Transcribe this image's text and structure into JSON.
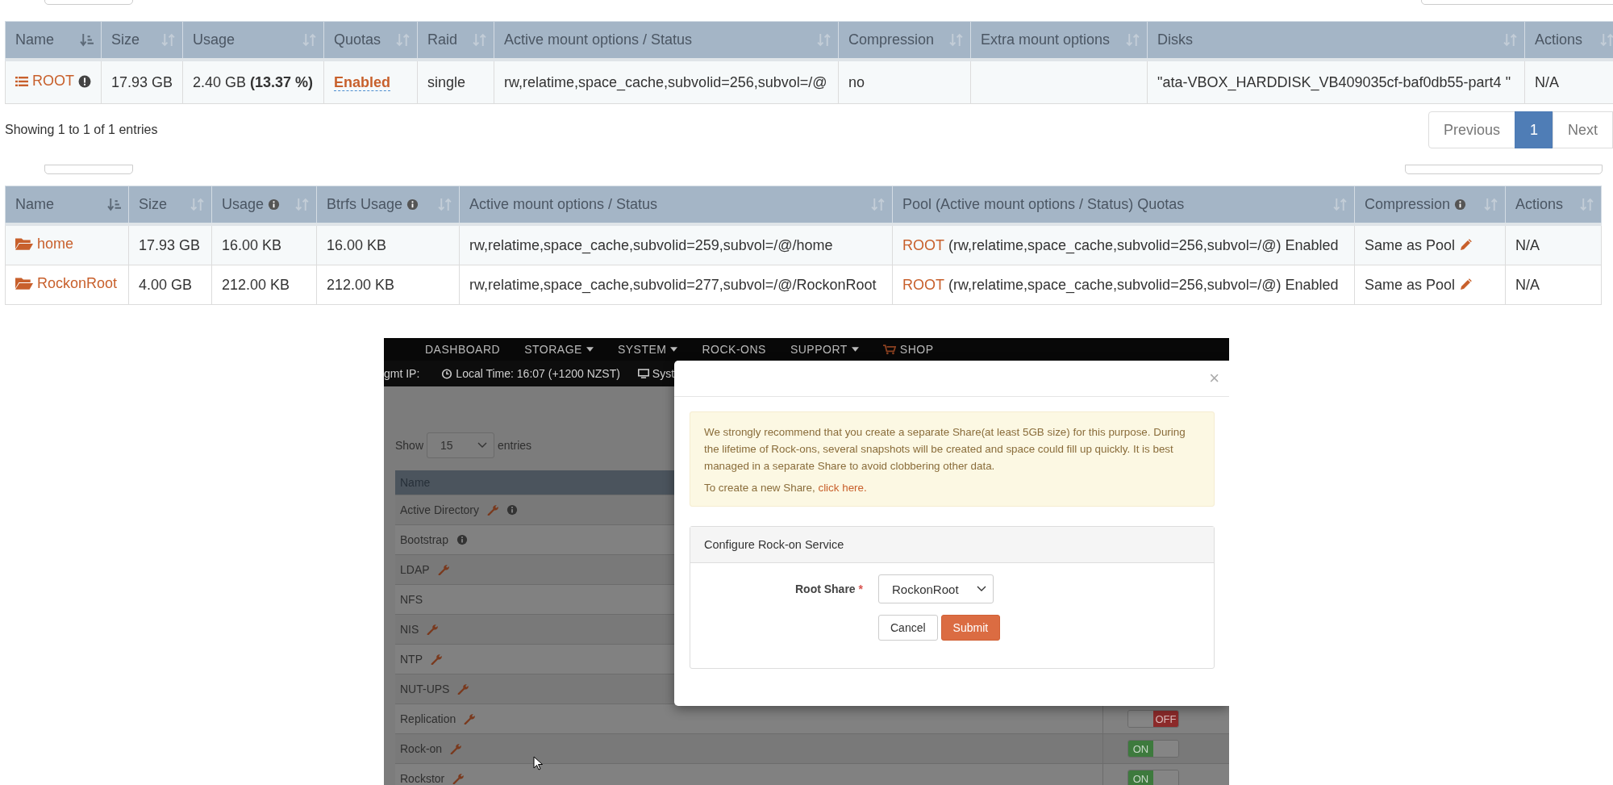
{
  "pools_table": {
    "columns": [
      {
        "label": "Name",
        "sorted": true,
        "info": false
      },
      {
        "label": "Size",
        "sorted": false,
        "info": false
      },
      {
        "label": "Usage",
        "sorted": false,
        "info": false
      },
      {
        "label": "Quotas",
        "sorted": false,
        "info": false
      },
      {
        "label": "Raid",
        "sorted": false,
        "info": false
      },
      {
        "label": "Active mount options / Status",
        "sorted": false,
        "info": false
      },
      {
        "label": "Compression",
        "sorted": false,
        "info": false
      },
      {
        "label": "Extra mount options",
        "sorted": false,
        "info": false
      },
      {
        "label": "Disks",
        "sorted": false,
        "info": false
      },
      {
        "label": "Actions",
        "sorted": false,
        "info": false
      }
    ],
    "rows": [
      {
        "cells": [
          {
            "kind": "pool-link",
            "text": "ROOT"
          },
          {
            "kind": "text",
            "text": "17.93 GB"
          },
          {
            "kind": "text",
            "text": "2.40 GB **(13.37 %)**"
          },
          {
            "kind": "quota-link",
            "text": "Enabled"
          },
          {
            "kind": "text",
            "text": "single"
          },
          {
            "kind": "text",
            "text": "rw,relatime,space_cache,subvolid=256,subvol=/@"
          },
          {
            "kind": "text",
            "text": "no"
          },
          {
            "kind": "empty"
          },
          {
            "kind": "text",
            "text": "\"ata-VBOX_HARDDISK_VB409035cf-baf0db55-part4 \""
          },
          {
            "kind": "text",
            "text": "N/A"
          }
        ]
      }
    ]
  },
  "pools_info": "Showing 1 to 1 of 1 entries",
  "pagination": [
    {
      "label": "Previous",
      "selected": false
    },
    {
      "label": "1",
      "selected": true
    },
    {
      "label": "Next",
      "selected": false
    }
  ],
  "shares_table": {
    "columns": [
      {
        "label": "Name",
        "sorted": true,
        "info": false
      },
      {
        "label": "Size",
        "sorted": false,
        "info": false
      },
      {
        "label": "Usage",
        "sorted": false,
        "info": true
      },
      {
        "label": "Btrfs Usage",
        "sorted": false,
        "info": true
      },
      {
        "label": "Active mount options / Status",
        "sorted": false,
        "info": false
      },
      {
        "label": "Pool (Active mount options / Status) Quotas",
        "sorted": false,
        "info": false
      },
      {
        "label": "Compression",
        "sorted": false,
        "info": true
      },
      {
        "label": "Actions",
        "sorted": false,
        "info": false
      }
    ],
    "rows": [
      {
        "cells": [
          {
            "kind": "share-link",
            "text": "home"
          },
          {
            "kind": "text",
            "text": "17.93 GB"
          },
          {
            "kind": "text",
            "text": "16.00 KB"
          },
          {
            "kind": "text",
            "text": "16.00 KB"
          },
          {
            "kind": "text",
            "text": "rw,relatime,space_cache,subvolid=259,subvol=/@/home"
          },
          {
            "kind": "pool-ref",
            "link": "ROOT",
            "text": "(rw,relatime,space_cache,subvolid=256,subvol=/@) Enabled"
          },
          {
            "kind": "editable",
            "text": "Same as Pool"
          },
          {
            "kind": "text",
            "text": "N/A"
          }
        ]
      },
      {
        "cells": [
          {
            "kind": "share-link",
            "text": "RockonRoot"
          },
          {
            "kind": "text",
            "text": "4.00 GB"
          },
          {
            "kind": "text",
            "text": "212.00 KB"
          },
          {
            "kind": "text",
            "text": "212.00 KB"
          },
          {
            "kind": "text",
            "text": "rw,relatime,space_cache,subvolid=277,subvol=/@/RockonRoot"
          },
          {
            "kind": "pool-ref",
            "link": "ROOT",
            "text": "(rw,relatime,space_cache,subvolid=256,subvol=/@) Enabled"
          },
          {
            "kind": "editable",
            "text": "Same as Pool"
          },
          {
            "kind": "text",
            "text": "N/A"
          }
        ]
      }
    ]
  },
  "embedded_screenshot": {
    "nav_items": [
      {
        "label": "DASHBOARD",
        "kind": "text",
        "dropdown": false
      },
      {
        "label": "STORAGE",
        "kind": "text",
        "dropdown": true
      },
      {
        "label": "SYSTEM",
        "kind": "text",
        "dropdown": true
      },
      {
        "label": "ROCK-ONS",
        "kind": "text",
        "dropdown": false
      },
      {
        "label": "SUPPORT",
        "kind": "text",
        "dropdown": true
      },
      {
        "label": "SHOP",
        "kind": "cart",
        "dropdown": false
      }
    ],
    "status_items": [
      {
        "kind": "plain",
        "text": "gmt IP:"
      },
      {
        "kind": "clock",
        "text": "Local Time: 16:07 (+1200 NZST)"
      },
      {
        "kind": "monitor",
        "text": "Syst"
      }
    ],
    "show_label": "Show",
    "page_length": "15",
    "entries_label": "entries",
    "table": {
      "column": "Name",
      "rows": [
        {
          "name": "Active Directory",
          "wrench": true,
          "info": true
        },
        {
          "name": "Bootstrap",
          "wrench": false,
          "info": true
        },
        {
          "name": "LDAP",
          "wrench": true,
          "info": false
        },
        {
          "name": "NFS",
          "wrench": false,
          "info": false
        },
        {
          "name": "NIS",
          "wrench": true,
          "info": false
        },
        {
          "name": "NTP",
          "wrench": true,
          "info": false
        },
        {
          "name": "NUT-UPS",
          "wrench": true,
          "info": false
        },
        {
          "name": "Replication",
          "wrench": true,
          "info": false,
          "toggle": {
            "on": false,
            "label": "OFF"
          }
        },
        {
          "name": "Rock-on",
          "wrench": true,
          "info": false,
          "toggle": {
            "on": true,
            "label": "ON"
          }
        },
        {
          "name": "Rockstor",
          "wrench": true,
          "info": false,
          "toggle": {
            "on": true,
            "label": "ON"
          }
        }
      ]
    },
    "modal": {
      "close_label": "×",
      "alert_text": "We strongly recommend that you create a separate Share(at least 5GB size) for this purpose. During the lifetime of Rock-ons, several snapshots will be created and space could fill up quickly. It is best managed in a separate Share to avoid clobbering other data.",
      "alert_link_prefix": "To create a new Share,",
      "alert_link": "click here.",
      "panel_title": "Configure Rock-on Service",
      "field_label": "Root Share",
      "required": true,
      "required_mark": "*",
      "field_value": "RockonRoot",
      "buttons": [
        {
          "label": "Cancel",
          "kind": "default"
        },
        {
          "label": "Submit",
          "kind": "primary"
        }
      ]
    }
  }
}
